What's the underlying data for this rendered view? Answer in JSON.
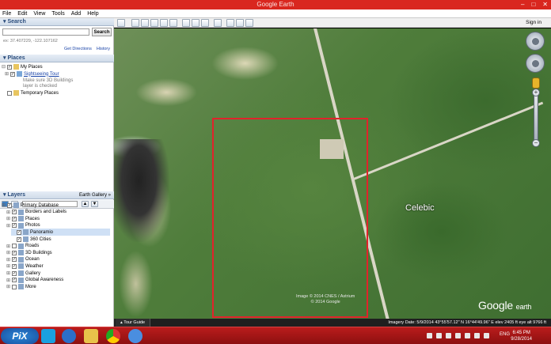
{
  "window": {
    "title": "Google Earth",
    "controls": [
      "–",
      "□",
      "✕"
    ]
  },
  "menu": [
    "File",
    "Edit",
    "View",
    "Tools",
    "Add",
    "Help"
  ],
  "toolbar": {
    "signin": "Sign in"
  },
  "search": {
    "header": "Search",
    "button": "Search",
    "hint": "ex: 37.407229, -122.107162",
    "links": [
      "Get Directions",
      "History"
    ]
  },
  "places": {
    "header": "Places",
    "items": [
      {
        "label": "My Places",
        "checked": true
      },
      {
        "label": "Sightseeing Tour",
        "checked": true,
        "link": true
      },
      {
        "label": "Make sure 3D Buildings",
        "note": true
      },
      {
        "label": "layer is checked",
        "note": true
      },
      {
        "label": "Temporary Places",
        "checked": false
      }
    ]
  },
  "layers": {
    "header": "Layers",
    "gallery": "Earth Gallery »",
    "items": [
      {
        "label": "Primary Database",
        "checked": true,
        "indent": 0
      },
      {
        "label": "Borders and Labels",
        "checked": true,
        "indent": 1
      },
      {
        "label": "Places",
        "checked": true,
        "indent": 1
      },
      {
        "label": "Photos",
        "checked": true,
        "indent": 1
      },
      {
        "label": "Panoramio",
        "checked": true,
        "indent": 2,
        "selected": true
      },
      {
        "label": "360 Cities",
        "checked": true,
        "indent": 2
      },
      {
        "label": "Roads",
        "checked": false,
        "indent": 1
      },
      {
        "label": "3D Buildings",
        "checked": true,
        "indent": 1
      },
      {
        "label": "Ocean",
        "checked": true,
        "indent": 1
      },
      {
        "label": "Weather",
        "checked": true,
        "indent": 1
      },
      {
        "label": "Gallery",
        "checked": true,
        "indent": 1
      },
      {
        "label": "Global Awareness",
        "checked": true,
        "indent": 1
      },
      {
        "label": "More",
        "checked": false,
        "indent": 1
      }
    ]
  },
  "map": {
    "place_label": "Celebic",
    "credit1": "Image © 2014 CNES / Astrium",
    "credit2": "© 2014 Google",
    "logo_main": "Google",
    "logo_sub": "earth"
  },
  "status": {
    "tour": "Tour Guide",
    "text": "Imagery Date: 5/9/2014   43°55'57.12\" N  16°44'49.96\" E  elev 2405 ft   eye alt  9766 ft"
  },
  "taskbar": {
    "time": "6:45 PM",
    "date": "9/28/2014",
    "lang": "ENG",
    "pix": "PiX"
  },
  "colors": {
    "titlebar": "#d9271f",
    "taskbar": "#b91c1c",
    "selection_box": "#e1232b"
  }
}
